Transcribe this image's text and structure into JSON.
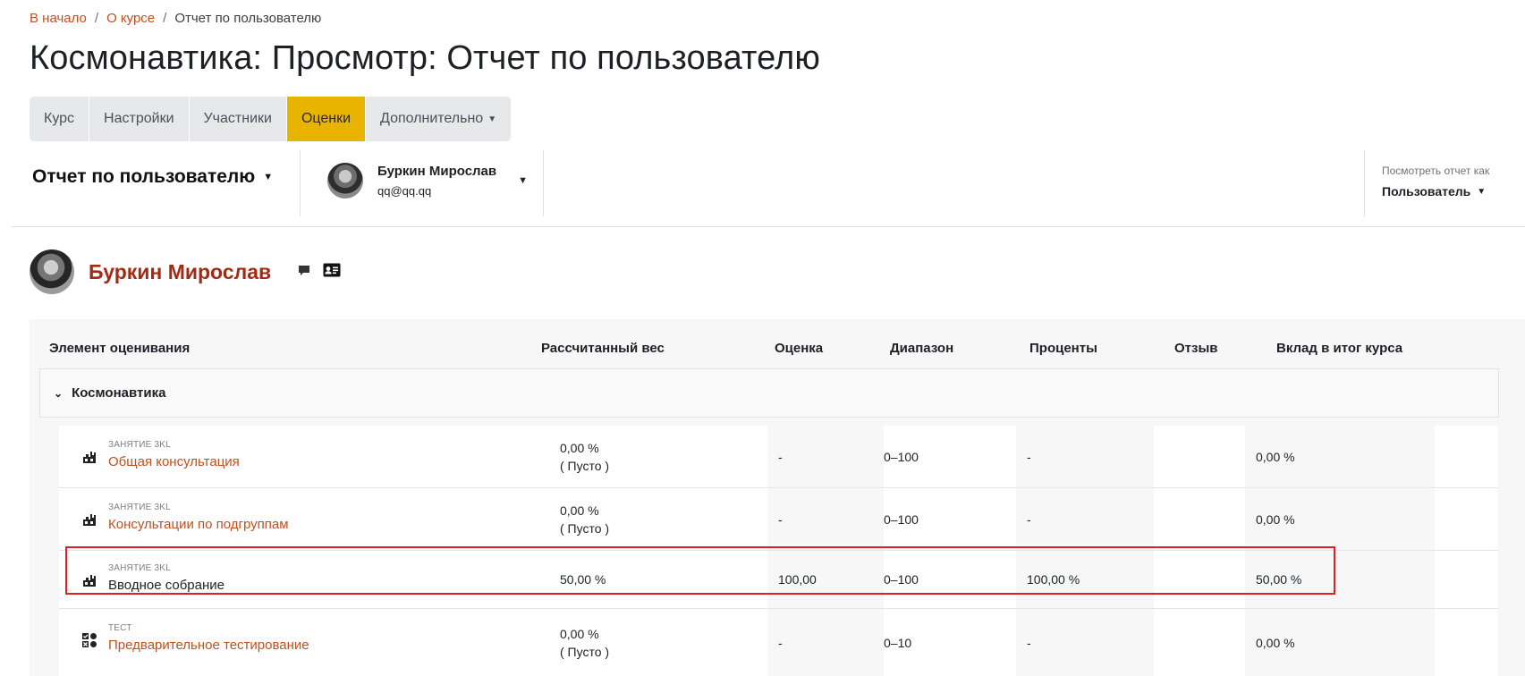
{
  "breadcrumb": {
    "home": "В начало",
    "course": "О курсе",
    "current": "Отчет по пользователю",
    "separator": "/"
  },
  "page_title": "Космонавтика: Просмотр: Отчет по пользователю",
  "tabs": [
    {
      "label": "Курс",
      "active": false
    },
    {
      "label": "Настройки",
      "active": false
    },
    {
      "label": "Участники",
      "active": false
    },
    {
      "label": "Оценки",
      "active": true
    },
    {
      "label": "Дополнительно",
      "active": false
    }
  ],
  "toolbar": {
    "report_label": "Отчет по пользователю",
    "user_name": "Буркин Мирослав",
    "user_email": "qq@qq.qq",
    "view_as_label": "Посмотреть отчет как",
    "view_as_value": "Пользователь"
  },
  "user": {
    "name": "Буркин Мирослав"
  },
  "table": {
    "headers": {
      "item": "Элемент оценивания",
      "weight": "Рассчитанный вес",
      "grade": "Оценка",
      "range": "Диапазон",
      "percent": "Проценты",
      "feedback": "Отзыв",
      "contribution": "Вклад в итог курса"
    },
    "category": "Космонавтика",
    "rows": [
      {
        "type": "Занятие 3KL",
        "name": "Общая консультация",
        "weight": "0,00 %",
        "weight_note": "( Пусто )",
        "grade": "-",
        "range": "0–100",
        "percent": "-",
        "feedback": "",
        "contribution": "0,00 %",
        "link": true,
        "icon": "activity-icon"
      },
      {
        "type": "Занятие 3KL",
        "name": "Консультации по подгруппам",
        "weight": "0,00 %",
        "weight_note": "( Пусто )",
        "grade": "-",
        "range": "0–100",
        "percent": "-",
        "feedback": "",
        "contribution": "0,00 %",
        "link": true,
        "icon": "activity-icon"
      },
      {
        "type": "Занятие 3KL",
        "name": "Вводное собрание",
        "weight": "50,00 %",
        "weight_note": "",
        "grade": "100,00",
        "range": "0–100",
        "percent": "100,00 %",
        "feedback": "",
        "contribution": "50,00 %",
        "link": false,
        "icon": "activity-icon",
        "highlighted": true
      },
      {
        "type": "Тест",
        "name": "Предварительное тестирование",
        "weight": "0,00 %",
        "weight_note": "( Пусто )",
        "grade": "-",
        "range": "0–10",
        "percent": "-",
        "feedback": "",
        "contribution": "0,00 %",
        "link": true,
        "icon": "quiz-icon"
      }
    ]
  },
  "colors": {
    "accent": "#c0501d",
    "active_tab": "#e8b400",
    "user_name": "#a52a14",
    "highlight_border": "#e02020"
  }
}
